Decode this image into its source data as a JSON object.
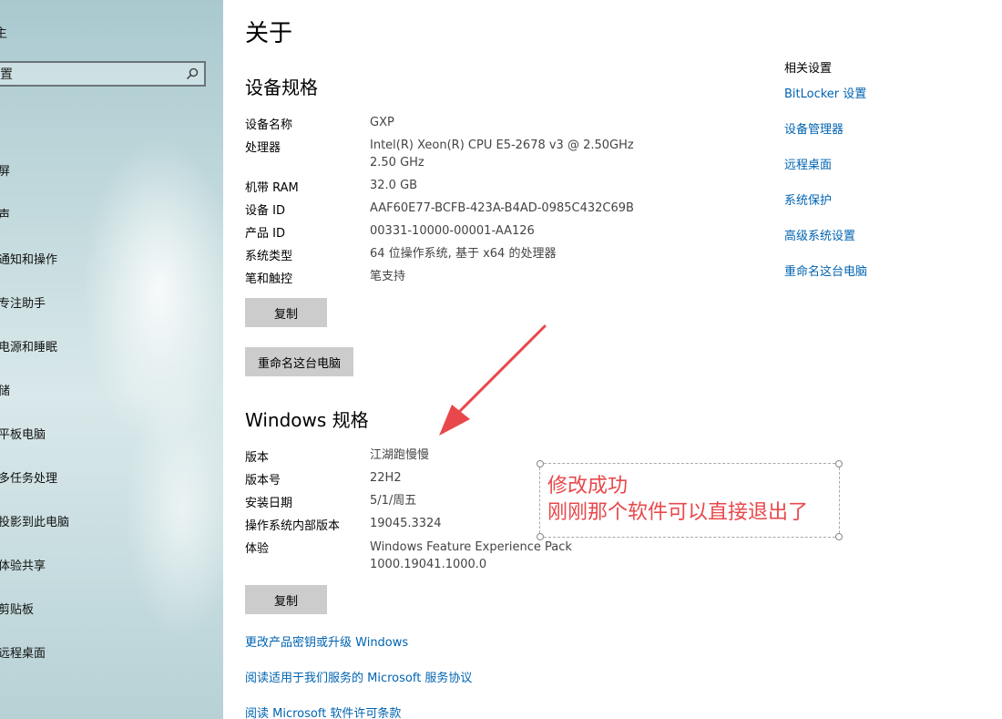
{
  "sidebar": {
    "top_char": "主",
    "search": {
      "value": "置"
    },
    "items": [
      {
        "label": "屏"
      },
      {
        "label": "声"
      },
      {
        "label": "通知和操作"
      },
      {
        "label": "专注助手"
      },
      {
        "label": "电源和睡眠"
      },
      {
        "label": "储"
      },
      {
        "label": "平板电脑"
      },
      {
        "label": "多任务处理"
      },
      {
        "label": "投影到此电脑"
      },
      {
        "label": "体验共享"
      },
      {
        "label": "剪贴板"
      },
      {
        "label": "远程桌面"
      }
    ]
  },
  "main": {
    "title": "关于",
    "device_section": {
      "title": "设备规格",
      "rows": [
        {
          "label": "设备名称",
          "value": "GXP"
        },
        {
          "label": "处理器",
          "value": "Intel(R) Xeon(R) CPU E5-2678 v3 @ 2.50GHz   2.50 GHz"
        },
        {
          "label": "机带 RAM",
          "value": "32.0 GB"
        },
        {
          "label": "设备 ID",
          "value": "AAF60E77-BCFB-423A-B4AD-0985C432C69B"
        },
        {
          "label": "产品 ID",
          "value": "00331-10000-00001-AA126"
        },
        {
          "label": "系统类型",
          "value": "64 位操作系统, 基于 x64 的处理器"
        },
        {
          "label": "笔和触控",
          "value": "笔支持"
        }
      ],
      "copy_button": "复制",
      "rename_button": "重命名这台电脑"
    },
    "windows_section": {
      "title": "Windows 规格",
      "rows": [
        {
          "label": "版本",
          "value": "江湖跑慢慢"
        },
        {
          "label": "版本号",
          "value": "22H2"
        },
        {
          "label": "安装日期",
          "value": "5/1/周五"
        },
        {
          "label": "操作系统内部版本",
          "value": "19045.3324"
        },
        {
          "label": "体验",
          "value": "Windows Feature Experience Pack 1000.19041.1000.0"
        }
      ],
      "copy_button": "复制"
    },
    "links": [
      {
        "label": "更改产品密钥或升级 Windows"
      },
      {
        "label": "阅读适用于我们服务的 Microsoft 服务协议"
      },
      {
        "label": "阅读 Microsoft 软件许可条款"
      }
    ]
  },
  "related": {
    "title": "相关设置",
    "links": [
      {
        "label": "BitLocker 设置"
      },
      {
        "label": "设备管理器"
      },
      {
        "label": "远程桌面"
      },
      {
        "label": "系统保护"
      },
      {
        "label": "高级系统设置"
      },
      {
        "label": "重命名这台电脑"
      }
    ]
  },
  "annotation": {
    "line1": "修改成功",
    "line2": "刚刚那个软件可以直接退出了",
    "color": "#e8484b"
  }
}
